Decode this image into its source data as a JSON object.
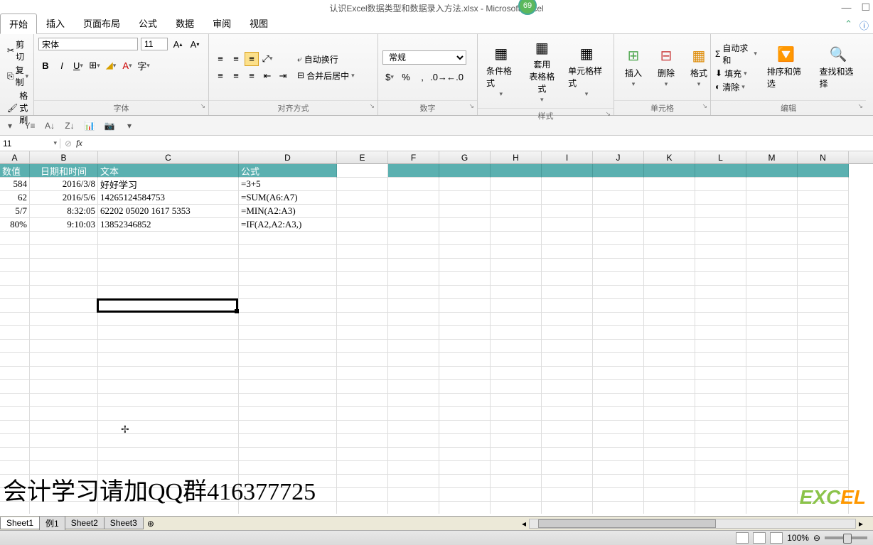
{
  "title": "认识Excel数据类型和数据录入方法.xlsx - Microsoft Excel",
  "badge": "69",
  "tabs": [
    "开始",
    "插入",
    "页面布局",
    "公式",
    "数据",
    "审阅",
    "视图"
  ],
  "active_tab": 0,
  "clipboard": {
    "cut": "剪切",
    "copy": "复制",
    "paint": "格式刷"
  },
  "groups": {
    "font": "字体",
    "align": "对齐方式",
    "number": "数字",
    "styles": "样式",
    "cells": "单元格",
    "editing": "编辑"
  },
  "font": {
    "name": "宋体",
    "size": "11"
  },
  "align": {
    "wrap": "自动换行",
    "merge": "合并后居中"
  },
  "number": {
    "format": "常规"
  },
  "styles": {
    "cond": "条件格式",
    "table": "套用\n表格格式",
    "cell": "单元格样式"
  },
  "cells": {
    "insert": "插入",
    "delete": "删除",
    "format": "格式"
  },
  "editing": {
    "autosum": "自动求和",
    "fill": "填充",
    "clear": "清除",
    "sort": "排序和筛选",
    "find": "查找和选择"
  },
  "name_box": "11",
  "col_headers": [
    "A",
    "B",
    "C",
    "D",
    "E",
    "F",
    "G",
    "H",
    "I",
    "J",
    "K",
    "L",
    "M",
    "N"
  ],
  "header_row": [
    "数值",
    "日期和时间",
    "文本",
    "公式"
  ],
  "rows": [
    {
      "a": "584",
      "b": "2016/3/8",
      "c": "好好学习",
      "d": "=3+5"
    },
    {
      "a": "62",
      "b": "2016/5/6",
      "c": "14265124584753",
      "d": "=SUM(A6:A7)"
    },
    {
      "a": "5/7",
      "b": "8:32:05",
      "c": "62202 05020 1617 5353",
      "d": "=MIN(A2:A3)"
    },
    {
      "a": "80%",
      "b": "9:10:03",
      "c": "13852346852",
      "d": "=IF(A2,A2:A3,)"
    }
  ],
  "sheets": [
    "Sheet1",
    "例1",
    "Sheet2",
    "Sheet3"
  ],
  "active_sheet": 0,
  "zoom": "100%",
  "overlay": "会计学习请加QQ群416377725",
  "logo": "EXCEL"
}
